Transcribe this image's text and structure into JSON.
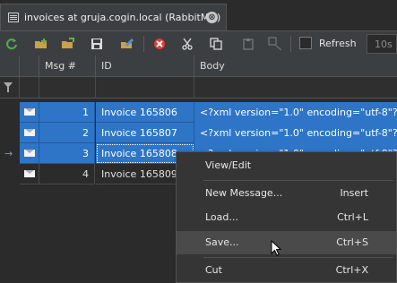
{
  "tab": {
    "title": "invoices at gruja.cogin.local (RabbitMQ)",
    "close": "⊗"
  },
  "toolbar": {
    "refresh_label": "Refresh",
    "interval_value": "10s",
    "icons": [
      "refresh-icon",
      "new-folder-icon",
      "open-folder-icon",
      "save-icon",
      "edit-icon",
      "delete-icon",
      "cut-icon",
      "copy-icon",
      "paste-icon",
      "multiply-icon"
    ]
  },
  "grid": {
    "columns": [
      "Msg #",
      "ID",
      "Body"
    ],
    "rows": [
      {
        "num": "1",
        "id": "Invoice 165806",
        "body": "<?xml version=\"1.0\" encoding=\"utf-8\"?>"
      },
      {
        "num": "2",
        "id": "Invoice 165807",
        "body": "<?xml version=\"1.0\" encoding=\"utf-8\"?>"
      },
      {
        "num": "3",
        "id": "Invoice 165808",
        "body": "<?xml version=\"1.0\" encoding=\"utf-8\"?>"
      },
      {
        "num": "4",
        "id": "Invoice 165809",
        "body": ""
      }
    ],
    "current_row_marker": "→"
  },
  "context_menu": {
    "items": [
      {
        "label": "View/Edit",
        "shortcut": ""
      },
      {
        "label": "New Message...",
        "shortcut": "Insert"
      },
      {
        "label": "Load...",
        "shortcut": "Ctrl+L"
      },
      {
        "label": "Save...",
        "shortcut": "Ctrl+S"
      },
      {
        "label": "Cut",
        "shortcut": "Ctrl+X"
      }
    ]
  },
  "colors": {
    "selection": "#2e75c7",
    "background": "#2b2b2b",
    "toolbar": "#3c3f41"
  }
}
